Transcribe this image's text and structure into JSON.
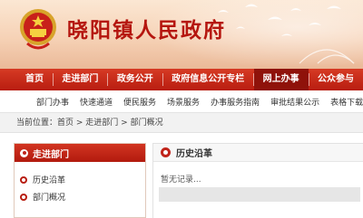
{
  "site": {
    "title": "晓阳镇人民政府"
  },
  "main_nav": {
    "items": [
      {
        "label": "首页"
      },
      {
        "label": "走进部门"
      },
      {
        "label": "政务公开"
      },
      {
        "label": "政府信息公开专栏"
      },
      {
        "label": "网上办事"
      },
      {
        "label": "公众参与"
      }
    ]
  },
  "sub_nav": {
    "items": [
      {
        "label": "部门办事"
      },
      {
        "label": "快速通道"
      },
      {
        "label": "便民服务"
      },
      {
        "label": "场景服务"
      },
      {
        "label": "办事服务指南"
      },
      {
        "label": "审批结果公示"
      },
      {
        "label": "表格下载"
      }
    ]
  },
  "breadcrumb": {
    "prefix": "当前位置：",
    "items": [
      "首页",
      "走进部门",
      "部门概况"
    ],
    "separator": " > "
  },
  "left_panel": {
    "title": "走进部门",
    "items": [
      {
        "label": "历史沿革"
      },
      {
        "label": "部门概况"
      }
    ]
  },
  "right_panel": {
    "title": "历史沿革",
    "empty_text": "暂无记录..."
  },
  "colors": {
    "brand_red": "#b81d10",
    "title_red": "#b5160f",
    "banner_bg": "#f6d2b6"
  }
}
